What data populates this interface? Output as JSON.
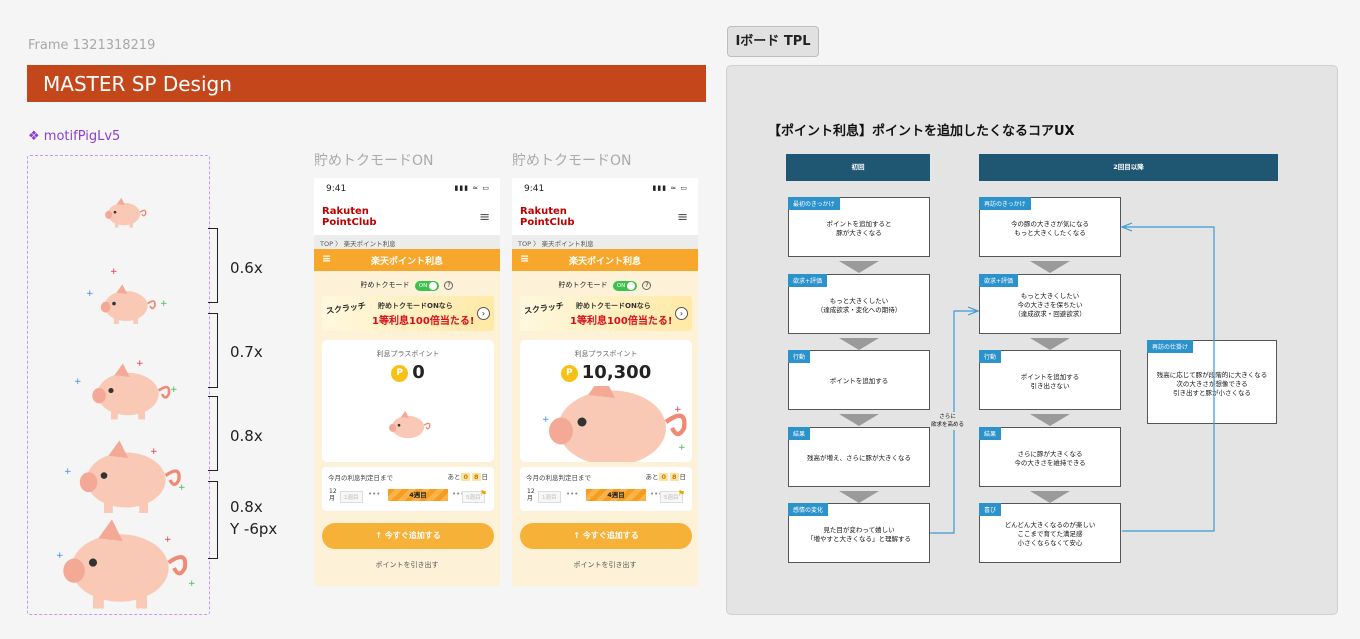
{
  "frame_label": "Frame 1321318219",
  "banner_title": "MASTER SP Design",
  "motif_label": "❖ motifPigLv5",
  "scales": [
    "0.6x",
    "0.7x",
    "0.8x",
    "0.8x",
    "Y -6px"
  ],
  "phones": [
    {
      "title": "貯めトクモードON",
      "time": "9:41",
      "status_icons": "▮▮▮ ≈ ▭",
      "logo_line1": "Rakuten",
      "logo_line2": "PointClub",
      "menu_icon": "≡",
      "breadcrumb": "TOP 〉 楽天ポイント利息",
      "bar_title": "楽天ポイント利息",
      "mode_label": "貯めトクモード",
      "toggle": "ON",
      "help": "?",
      "promo_left": "スクラッチ",
      "promo_line1": "貯めトクモードONなら",
      "promo_line2": "1等利息100倍当たる!",
      "card_label": "利息プラスポイント",
      "coin": "P",
      "points": "0",
      "deadline_label": "今月の利息判定日まで",
      "days_prefix": "あと",
      "days_d1": "0",
      "days_d2": "8",
      "days_suffix": "日",
      "month": "12\n月",
      "week_chip1": "1週目",
      "dots": "•••",
      "week_current": "4週目",
      "week_chip2": "5週目",
      "add_button": "↑ 今すぐ追加する",
      "withdraw_link": "ポイントを引き出す"
    },
    {
      "title": "貯めトクモードON",
      "time": "9:41",
      "status_icons": "▮▮▮ ≈ ▭",
      "logo_line1": "Rakuten",
      "logo_line2": "PointClub",
      "menu_icon": "≡",
      "breadcrumb": "TOP 〉 楽天ポイント利息",
      "bar_title": "楽天ポイント利息",
      "mode_label": "貯めトクモード",
      "toggle": "ON",
      "help": "?",
      "promo_left": "スクラッチ",
      "promo_line1": "貯めトクモードONなら",
      "promo_line2": "1等利息100倍当たる!",
      "card_label": "利息プラスポイント",
      "coin": "P",
      "points": "10,300",
      "deadline_label": "今月の利息判定日まで",
      "days_prefix": "あと",
      "days_d1": "0",
      "days_d2": "8",
      "days_suffix": "日",
      "month": "12\n月",
      "week_chip1": "1週目",
      "dots": "•••",
      "week_current": "4週目",
      "week_chip2": "5週目",
      "add_button": "↑ 今すぐ追加する",
      "withdraw_link": "ポイントを引き出す"
    }
  ],
  "board": {
    "tab": "Iボード TPL",
    "title": "【ポイント利息】ポイントを追加したくなるコアUX",
    "col1_head": "初回",
    "col2_head": "2回目以降",
    "col1": [
      {
        "tag": "最初のきっかけ",
        "text": "ポイントを追加すると\n豚が大きくなる"
      },
      {
        "tag": "欲求+評価",
        "text": "もっと大きくしたい\n（達成欲求・変化への期待）"
      },
      {
        "tag": "行動",
        "text": "ポイントを追加する"
      },
      {
        "tag": "結果",
        "text": "残高が増え、さらに豚が大きくなる"
      },
      {
        "tag": "感情の変化",
        "text": "見た目が変わって嬉しい\n「増やすと大きくなる」と理解する"
      }
    ],
    "col2": [
      {
        "tag": "再訪のきっかけ",
        "text": "今の豚の大きさが気になる\nもっと大きくしたくなる"
      },
      {
        "tag": "欲求+評価",
        "text": "もっと大きくしたい\n今の大きさを保ちたい\n（達成欲求・回避欲求）"
      },
      {
        "tag": "行動",
        "text": "ポイントを追加する\n引き出さない"
      },
      {
        "tag": "結果",
        "text": "さらに豚が大きくなる\n今の大きさを維持できる"
      },
      {
        "tag": "喜び",
        "text": "どんどん大きくなるのが楽しい\nここまで育てた満足感\n小さくならなくて安心"
      }
    ],
    "side": {
      "tag": "再訪の仕掛け",
      "text": "残高に応じて豚が段階的に大きくなる\n次の大きさが想像できる\n引き出すと豚が小さくなる"
    },
    "connector_note": "さらに\n欲求を高める"
  }
}
